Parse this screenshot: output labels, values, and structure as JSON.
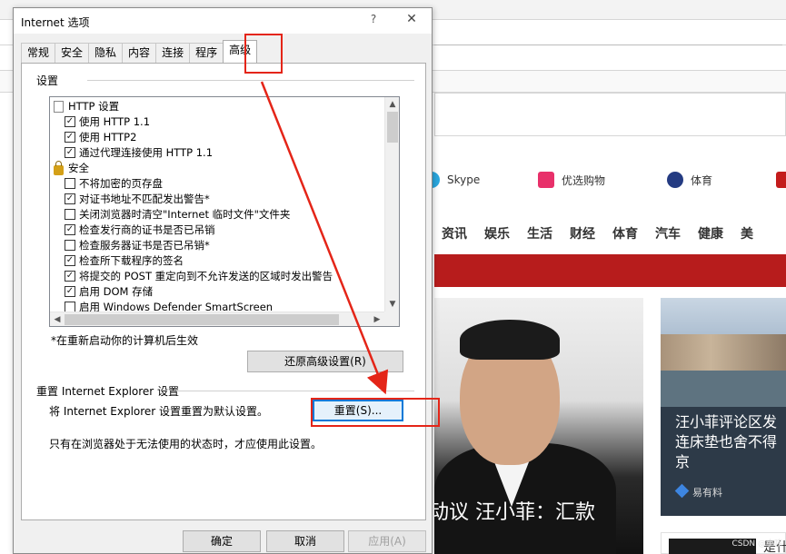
{
  "dialog": {
    "title": "Internet 选项",
    "help_label": "?",
    "close_label": "✕",
    "tabs": [
      {
        "label": "常规"
      },
      {
        "label": "安全"
      },
      {
        "label": "隐私"
      },
      {
        "label": "内容"
      },
      {
        "label": "连接"
      },
      {
        "label": "程序"
      },
      {
        "label": "高级",
        "active": true
      }
    ],
    "settings": {
      "group_label": "设置",
      "items": [
        {
          "type": "folder",
          "label": "HTTP 设置"
        },
        {
          "type": "check",
          "checked": true,
          "label": "使用 HTTP 1.1"
        },
        {
          "type": "check",
          "checked": true,
          "label": "使用 HTTP2"
        },
        {
          "type": "check",
          "checked": true,
          "label": "通过代理连接使用 HTTP 1.1"
        },
        {
          "type": "lock",
          "label": "安全"
        },
        {
          "type": "check",
          "checked": false,
          "label": "不将加密的页存盘"
        },
        {
          "type": "check",
          "checked": true,
          "label": "对证书地址不匹配发出警告*"
        },
        {
          "type": "check",
          "checked": false,
          "label": "关闭浏览器时清空\"Internet 临时文件\"文件夹"
        },
        {
          "type": "check",
          "checked": true,
          "label": "检查发行商的证书是否已吊销"
        },
        {
          "type": "check",
          "checked": false,
          "label": "检查服务器证书是否已吊销*"
        },
        {
          "type": "check",
          "checked": true,
          "label": "检查所下载程序的签名"
        },
        {
          "type": "check",
          "checked": true,
          "label": "将提交的 POST 重定向到不允许发送的区域时发出警告"
        },
        {
          "type": "check",
          "checked": true,
          "label": "启用 DOM 存储"
        },
        {
          "type": "check",
          "checked": false,
          "label": "启用 Windows Defender SmartScreen"
        },
        {
          "type": "check",
          "checked": false,
          "label": ""
        }
      ],
      "restart_note": "*在重新启动你的计算机后生效",
      "restore_button": "还原高级设置(R)"
    },
    "reset": {
      "group_label": "重置 Internet Explorer 设置",
      "description": "将 Internet Explorer 设置重置为默认设置。",
      "button": "重置(S)...",
      "warning": "只有在浏览器处于无法使用的状态时，才应使用此设置。"
    },
    "buttons": {
      "ok": "确定",
      "cancel": "取消",
      "apply": "应用(A)"
    }
  },
  "background": {
    "services": [
      {
        "label": "Skype",
        "icon": "skype-icon"
      },
      {
        "label": "优选购物",
        "icon": "shopping-bag-icon"
      },
      {
        "label": "体育",
        "icon": "soccer-ball-icon"
      }
    ],
    "categories": [
      "资讯",
      "娱乐",
      "生活",
      "财经",
      "体育",
      "汽车",
      "健康",
      "美"
    ],
    "news": [
      {
        "title": "动议 汪小菲：汇款"
      },
      {
        "title": "汪小菲评论区发 连床垫也舍不得 京",
        "source": "易有料"
      },
      {
        "title": "是什"
      }
    ],
    "watermark": "CSDN @小咤"
  },
  "colors": {
    "annotation_red": "#e42518",
    "focus_blue": "#0078d7",
    "site_red": "#b71c1c"
  }
}
